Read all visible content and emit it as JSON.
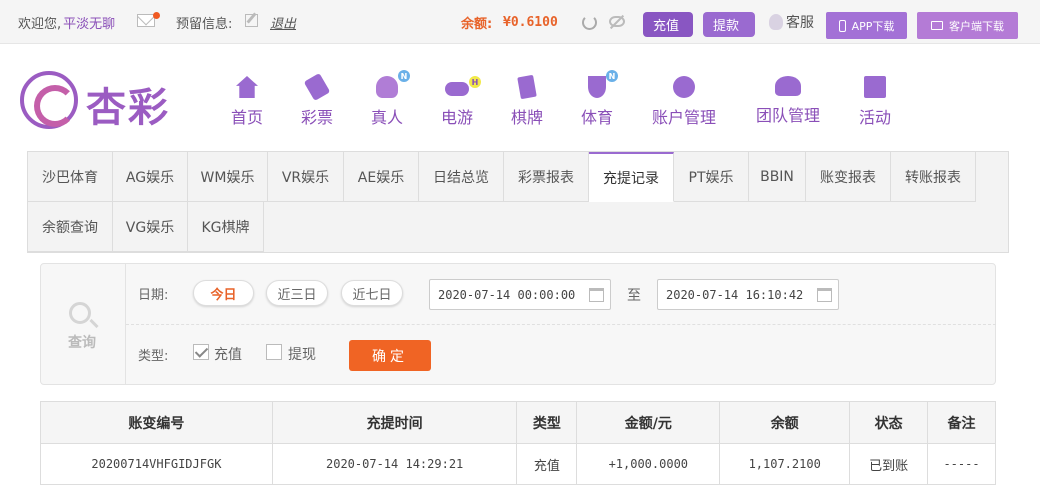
{
  "topbar": {
    "welcome": "欢迎您,",
    "username": "平淡无聊",
    "reserve_label": "预留信息:",
    "logout": "退出",
    "balance_label": "余额:",
    "balance": "¥0.6100",
    "topup": "充值",
    "withdraw": "提款",
    "service": "客服",
    "app_download": "APP下载",
    "client_download": "客户端下载"
  },
  "brand": {
    "logo_text": "杏彩"
  },
  "nav": [
    {
      "label": "首页",
      "icon": "home-icon",
      "badge": ""
    },
    {
      "label": "彩票",
      "icon": "lottery-ticket-icon",
      "badge": ""
    },
    {
      "label": "真人",
      "icon": "live-dealer-icon",
      "badge": "N"
    },
    {
      "label": "电游",
      "icon": "gamepad-icon",
      "badge": "H"
    },
    {
      "label": "棋牌",
      "icon": "cards-icon",
      "badge": ""
    },
    {
      "label": "体育",
      "icon": "trophy-icon",
      "badge": "N"
    },
    {
      "label": "账户管理",
      "icon": "coin-icon",
      "badge": ""
    },
    {
      "label": "团队管理",
      "icon": "team-icon",
      "badge": ""
    },
    {
      "label": "活动",
      "icon": "gift-icon",
      "badge": ""
    }
  ],
  "tabs": [
    "沙巴体育",
    "AG娱乐",
    "WM娱乐",
    "VR娱乐",
    "AE娱乐",
    "日结总览",
    "彩票报表",
    "充提记录",
    "PT娱乐",
    "BBIN",
    "账变报表",
    "转账报表",
    "余额查询",
    "VG娱乐",
    "KG棋牌"
  ],
  "active_tab": "充提记录",
  "filter": {
    "search_label": "查询",
    "date_label": "日期:",
    "quick_ranges": [
      "今日",
      "近三日",
      "近七日"
    ],
    "active_range": "今日",
    "start_datetime": "2020-07-14 00:00:00",
    "to_label": "至",
    "end_datetime": "2020-07-14 16:10:42",
    "type_label": "类型:",
    "type_topup": "充值",
    "type_withdraw": "提现",
    "topup_checked": true,
    "withdraw_checked": false,
    "confirm": "确定"
  },
  "table": {
    "columns": [
      "账变编号",
      "充提时间",
      "类型",
      "金额/元",
      "余额",
      "状态",
      "备注"
    ],
    "rows": [
      [
        "20200714VHFGIDJFGK",
        "2020-07-14 14:29:21",
        "充值",
        "+1,000.0000",
        "1,107.2100",
        "已到账",
        "-----"
      ]
    ]
  },
  "colors": {
    "brand_purple": "#8956c2",
    "accent_orange": "#f06424",
    "amount_red": "#e0342b",
    "status_green": "#27a13a"
  }
}
